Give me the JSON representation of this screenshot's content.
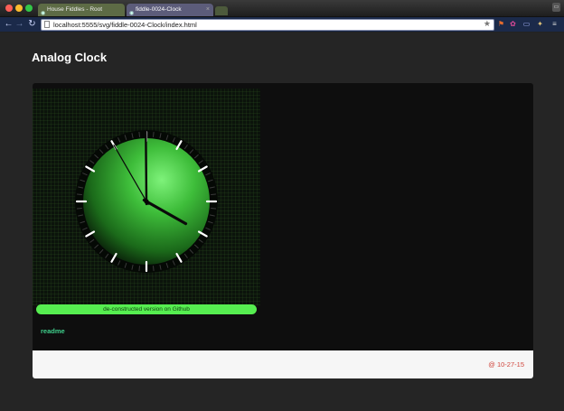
{
  "browser": {
    "tabs": [
      {
        "label": "House Fiddles - Root",
        "icon": "globe-icon"
      },
      {
        "label": "fiddle-0024-Clock",
        "icon": "globe-icon",
        "close": "×"
      }
    ],
    "url": "localhost:5555/svg/fiddle-0024-Clock/index.html",
    "nav": {
      "back": "←",
      "forward": "→",
      "reload": "C"
    },
    "bookmark_icon": "★",
    "extensions": [
      "flag-icon",
      "color-wheel-icon",
      "cast-icon",
      "puzzle-icon",
      "menu-icon"
    ]
  },
  "page": {
    "title": "Analog Clock",
    "github_label": "de-constructed version on Github",
    "readme_label": "readme",
    "date": "@ 10-27-15"
  },
  "clock": {
    "hour": 3,
    "minute": 59,
    "second": 55,
    "face_color": "#3ebd3a",
    "tick_color": "#ffffff",
    "hand_color": "#0a0a0a"
  },
  "colors": {
    "accent": "#56ee50",
    "readme": "#3fd08c",
    "date": "#d0453c"
  }
}
